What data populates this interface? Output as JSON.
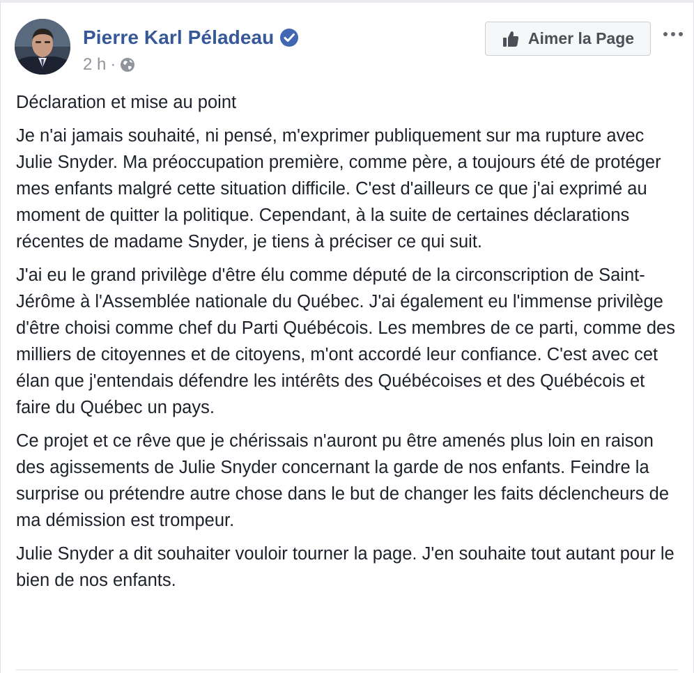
{
  "post": {
    "author": {
      "name": "Pierre Karl Péladeau",
      "verified": true,
      "avatar_icon": "profile-photo"
    },
    "meta": {
      "time": "2 h",
      "separator": "·",
      "audience_icon": "globe-icon"
    },
    "actions": {
      "like_page_label": "Aimer la Page",
      "like_icon": "thumbs-up-icon",
      "more_icon": "ellipsis-icon"
    },
    "paragraphs": [
      "Déclaration et mise au point",
      "Je n'ai jamais souhaité, ni pensé, m'exprimer publiquement sur ma rupture avec Julie Snyder. Ma préoccupation première, comme père, a toujours été de protéger mes enfants malgré cette situation difficile. C'est d'ailleurs ce que j'ai exprimé au moment de quitter la politique. Cependant, à la suite de certaines déclarations récentes de madame Snyder, je tiens à préciser ce qui suit.",
      "J'ai eu le grand privilège d'être élu comme député de la circonscription de Saint-Jérôme à l'Assemblée nationale du Québec. J'ai également eu l'immense privilège d'être choisi comme chef du Parti Québécois. Les membres de ce parti, comme des milliers de citoyennes et de citoyens, m'ont accordé leur confiance. C'est avec cet élan que j'entendais défendre les intérêts des Québécoises et des Québécois et faire du Québec un pays.",
      "Ce projet et ce rêve que je chérissais n'auront pu être amenés plus loin en raison des agissements de Julie Snyder concernant la garde de nos enfants. Feindre la surprise ou prétendre autre chose dans le but de changer les faits déclencheurs de ma démission est trompeur.",
      "Julie Snyder a dit souhaiter vouloir tourner la page. J'en souhaite tout autant pour le bien de nos enfants."
    ]
  },
  "colors": {
    "author_link": "#365899",
    "verified_badge": "#4267b2",
    "text": "#1d2129",
    "meta": "#90949c",
    "button_bg": "#f6f7f9",
    "button_border": "#ccd0d5",
    "button_text": "#4b4f56"
  }
}
